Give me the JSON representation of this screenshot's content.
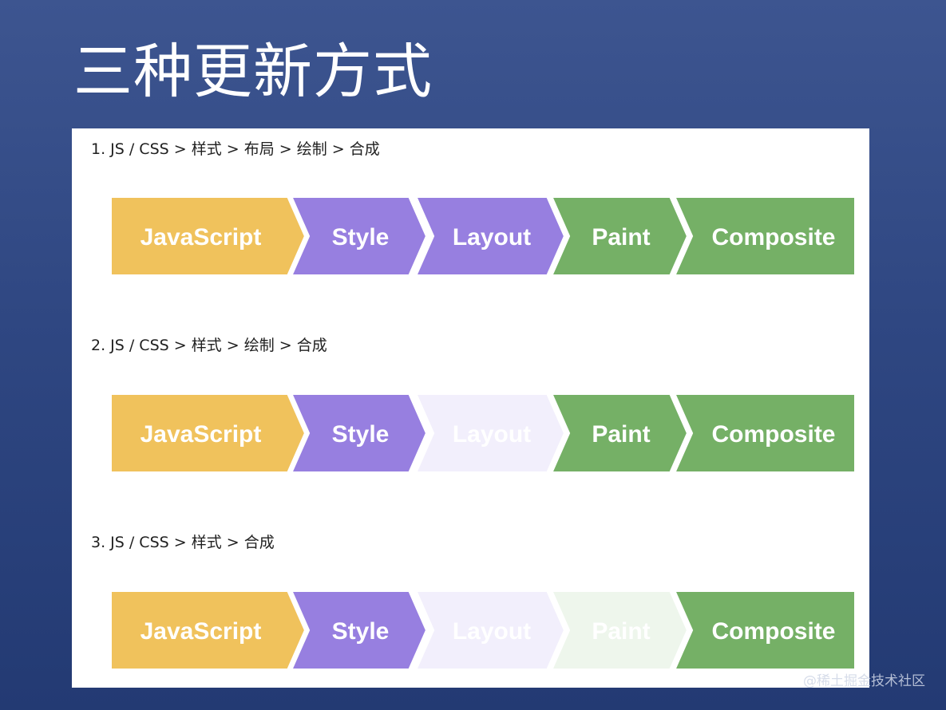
{
  "slide": {
    "title": "三种更新方式",
    "watermark": "@稀土掘金技术社区"
  },
  "colors": {
    "background": "#2f4782",
    "panel": "#ffffff",
    "javascript": "#f0c25c",
    "style": "#977fe0",
    "layout": "#977fe0",
    "paint": "#75b066",
    "composite": "#75b066",
    "layout_skipped": "#f2effc",
    "paint_skipped": "#eef6ec",
    "label_active": "#ffffff",
    "label_skipped": "#ffffff"
  },
  "rows": [
    {
      "caption": "1. JS / CSS > 样式 > 布局 > 绘制 > 合成",
      "steps": [
        {
          "id": "javascript",
          "label": "JavaScript",
          "active": true
        },
        {
          "id": "style",
          "label": "Style",
          "active": true
        },
        {
          "id": "layout",
          "label": "Layout",
          "active": true
        },
        {
          "id": "paint",
          "label": "Paint",
          "active": true
        },
        {
          "id": "composite",
          "label": "Composite",
          "active": true
        }
      ]
    },
    {
      "caption": "2. JS / CSS > 样式 > 绘制 > 合成",
      "steps": [
        {
          "id": "javascript",
          "label": "JavaScript",
          "active": true
        },
        {
          "id": "style",
          "label": "Style",
          "active": true
        },
        {
          "id": "layout",
          "label": "Layout",
          "active": false
        },
        {
          "id": "paint",
          "label": "Paint",
          "active": true
        },
        {
          "id": "composite",
          "label": "Composite",
          "active": true
        }
      ]
    },
    {
      "caption": "3. JS / CSS > 样式 > 合成",
      "steps": [
        {
          "id": "javascript",
          "label": "JavaScript",
          "active": true
        },
        {
          "id": "style",
          "label": "Style",
          "active": true
        },
        {
          "id": "layout",
          "label": "Layout",
          "active": false
        },
        {
          "id": "paint",
          "label": "Paint",
          "active": false
        },
        {
          "id": "composite",
          "label": "Composite",
          "active": true
        }
      ]
    }
  ]
}
